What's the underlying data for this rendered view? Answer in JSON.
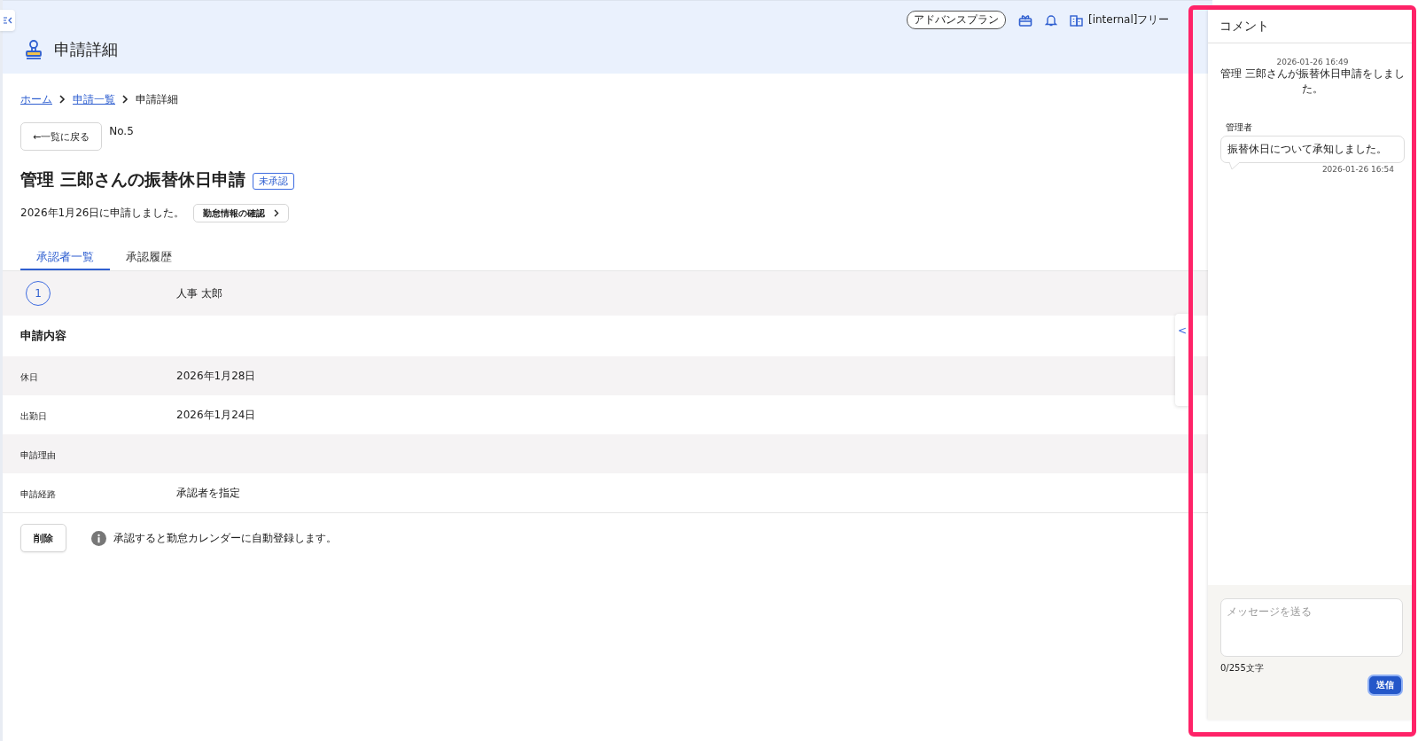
{
  "header": {
    "title": "申請詳細",
    "plan_badge": "アドバンスプラン",
    "org_name": "[internal]フリー"
  },
  "breadcrumb": [
    {
      "label": "ホーム",
      "link": true
    },
    {
      "label": "申請一覧",
      "link": true
    },
    {
      "label": "申請詳細",
      "link": false
    }
  ],
  "back_button": "←一覧に戻る",
  "number": "No.5",
  "request": {
    "title": "管理 三郎さんの振替休日申請",
    "status": "未承認"
  },
  "submitted_text": "2026年1月26日に申請しました。",
  "attendance_button": "勤怠情報の確認",
  "tabs": [
    {
      "label": "承認者一覧",
      "selected": true
    },
    {
      "label": "承認履歴",
      "selected": false
    }
  ],
  "approvers": [
    {
      "step": "1",
      "name": "人事 太郎"
    }
  ],
  "section_title": "申請内容",
  "fields": [
    {
      "label": "休日",
      "value": "2026年1月28日"
    },
    {
      "label": "出勤日",
      "value": "2026年1月24日"
    },
    {
      "label": "申請理由"
    },
    {
      "label": "申請経路",
      "value": "承認者を指定"
    }
  ],
  "delete_button": "削除",
  "notice": "承認すると勤怠カレンダーに自動登録します。",
  "side_tab": {
    "label": "<"
  },
  "comments": {
    "title": "コメント",
    "messages": [
      {
        "kind": "system",
        "time": "2026-01-26 16:49",
        "text": "管理 三郎さんが振替休日申請をしました。"
      },
      {
        "kind": "user",
        "author": "管理者",
        "text": "振替休日について承知しました。",
        "time": "2026-01-26 16:54"
      }
    ],
    "input": {
      "placeholder": "メッセージを送る"
    },
    "counter": "0/255文字",
    "send_button": "送信"
  }
}
